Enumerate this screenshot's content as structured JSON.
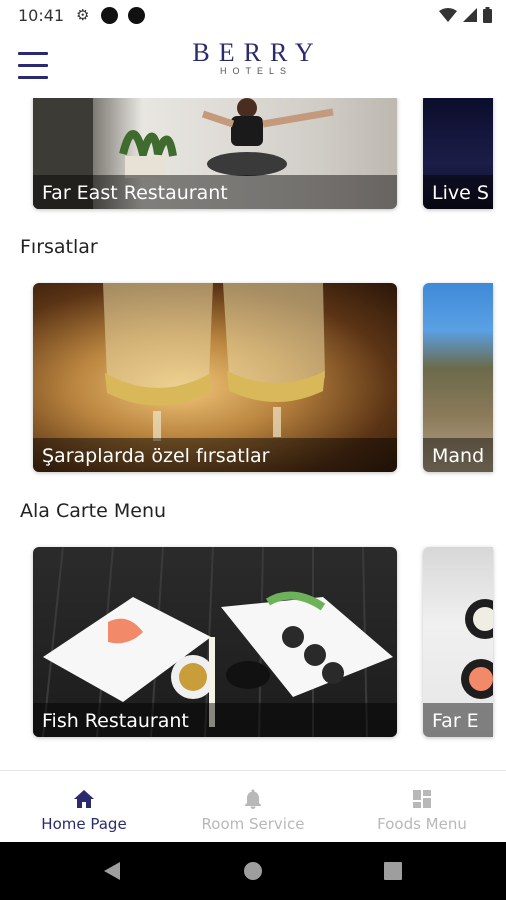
{
  "status_bar": {
    "time": "10:41"
  },
  "header": {
    "brand": "BERRY",
    "brand_sub": "HOTELS"
  },
  "sections": [
    {
      "title": "",
      "cards": [
        {
          "label": "Far East Restaurant"
        },
        {
          "label": "Live S"
        }
      ]
    },
    {
      "title": "Fırsatlar",
      "cards": [
        {
          "label": "Şaraplarda özel fırsatlar"
        },
        {
          "label": "Mand"
        }
      ]
    },
    {
      "title": "Ala Carte Menu",
      "cards": [
        {
          "label": "Fish Restaurant"
        },
        {
          "label": "Far E"
        }
      ]
    }
  ],
  "bottom_nav": {
    "items": [
      {
        "label": "Home Page",
        "icon": "home-icon",
        "active": true
      },
      {
        "label": "Room Service",
        "icon": "bell-icon",
        "active": false
      },
      {
        "label": "Foods Menu",
        "icon": "grid-icon",
        "active": false
      }
    ]
  },
  "colors": {
    "brand": "#2a2b6e",
    "inactive": "#b8b8b8"
  }
}
